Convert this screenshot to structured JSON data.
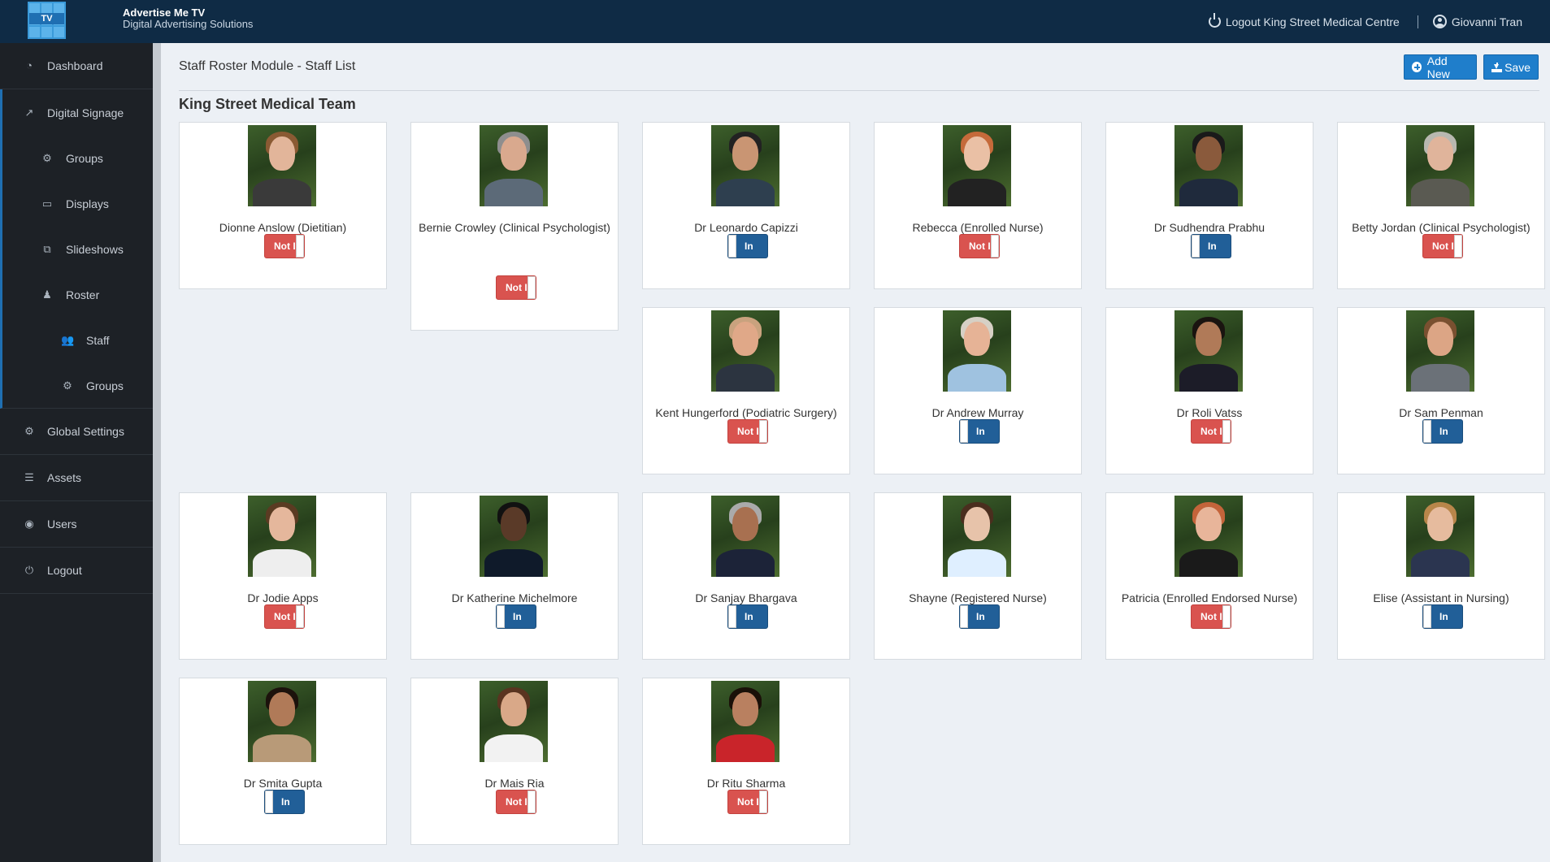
{
  "header": {
    "logo_text": "TV",
    "brand_title": "Advertise Me TV",
    "brand_subtitle": "Digital Advertising Solutions",
    "logout_label": "Logout King Street Medical Centre",
    "user_name": "Giovanni Tran",
    "bg_color": "#0f2b45"
  },
  "sidebar": {
    "items": [
      {
        "label": "Dashboard",
        "icon": "dashboard-icon"
      },
      {
        "label": "Digital Signage",
        "icon": "signage-icon"
      },
      {
        "label": "Groups",
        "icon": "groups-icon"
      },
      {
        "label": "Displays",
        "icon": "display-icon"
      },
      {
        "label": "Slideshows",
        "icon": "slideshow-icon"
      },
      {
        "label": "Roster",
        "icon": "roster-icon"
      },
      {
        "label": "Staff",
        "icon": "staff-icon"
      },
      {
        "label": "Groups",
        "icon": "groups-icon"
      },
      {
        "label": "Global Settings",
        "icon": "settings-icon"
      },
      {
        "label": "Assets",
        "icon": "assets-icon"
      },
      {
        "label": "Users",
        "icon": "users-icon"
      },
      {
        "label": "Logout",
        "icon": "power-icon"
      }
    ]
  },
  "main": {
    "page_title": "Staff Roster Module - Staff List",
    "add_new_label": "Add New",
    "save_label": "Save",
    "team_title": "King Street Medical Team",
    "on_label": "In",
    "off_label": "Not In",
    "accent_color": "#1f7ecb",
    "on_color": "#215f98",
    "off_color": "#d9534f"
  },
  "staff": [
    {
      "name": "Dionne Anslow (Dietitian)",
      "status": "off"
    },
    {
      "name": "Bernie Crowley (Clinical Psychologist)",
      "status": "off"
    },
    {
      "name": "Dr Leonardo Capizzi",
      "status": "on"
    },
    {
      "name": "Rebecca (Enrolled Nurse)",
      "status": "off"
    },
    {
      "name": "Dr Sudhendra Prabhu",
      "status": "on"
    },
    {
      "name": "Betty Jordan (Clinical Psychologist)",
      "status": "off"
    },
    {
      "name": "Kent Hungerford (Podiatric Surgery)",
      "status": "off"
    },
    {
      "name": "Dr Andrew Murray",
      "status": "on"
    },
    {
      "name": "Dr Roli Vatss",
      "status": "off"
    },
    {
      "name": "Dr Sam Penman",
      "status": "on"
    },
    {
      "name": "Dr Jodie Apps",
      "status": "off"
    },
    {
      "name": "Dr Katherine Michelmore",
      "status": "on"
    },
    {
      "name": "Dr Sanjay Bhargava",
      "status": "on"
    },
    {
      "name": "Shayne (Registered Nurse)",
      "status": "on"
    },
    {
      "name": "Patricia (Enrolled Endorsed Nurse)",
      "status": "off"
    },
    {
      "name": "Elise (Assistant in Nursing)",
      "status": "on"
    },
    {
      "name": "Dr Smita Gupta",
      "status": "on"
    },
    {
      "name": "Dr Mais Ria",
      "status": "off"
    },
    {
      "name": "Dr Ritu Sharma",
      "status": "off"
    }
  ]
}
